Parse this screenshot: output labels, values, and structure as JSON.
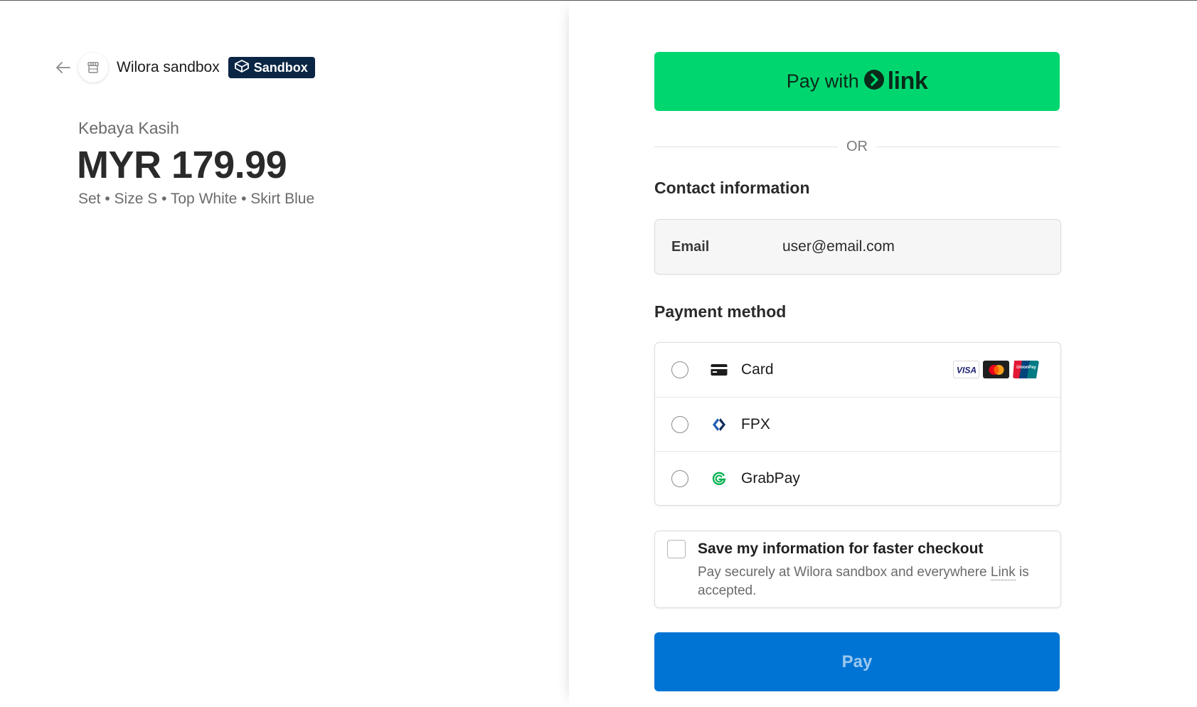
{
  "merchant": {
    "name": "Wilora sandbox",
    "badge": "Sandbox"
  },
  "product": {
    "name": "Kebaya Kasih",
    "price": "MYR 179.99",
    "variant": "Set • Size S • Top White • Skirt Blue"
  },
  "link_button": {
    "prefix": "Pay with",
    "brand": "link"
  },
  "divider": "OR",
  "contact": {
    "title": "Contact information",
    "email_label": "Email",
    "email_value": "user@email.com"
  },
  "payment": {
    "title": "Payment method",
    "methods": [
      {
        "label": "Card",
        "icon": "card-icon"
      },
      {
        "label": "FPX",
        "icon": "fpx-icon"
      },
      {
        "label": "GrabPay",
        "icon": "grabpay-icon"
      }
    ],
    "card_brands": [
      "visa-icon",
      "mastercard-icon",
      "unionpay-icon"
    ]
  },
  "save_info": {
    "title": "Save my information for faster checkout",
    "desc_prefix": "Pay securely at Wilora sandbox and everywhere ",
    "desc_link": "Link",
    "desc_suffix": " is accepted."
  },
  "pay_button": "Pay",
  "colors": {
    "link_green": "#00d66f",
    "pay_blue": "#0074d4",
    "badge_navy": "#0b2545"
  }
}
